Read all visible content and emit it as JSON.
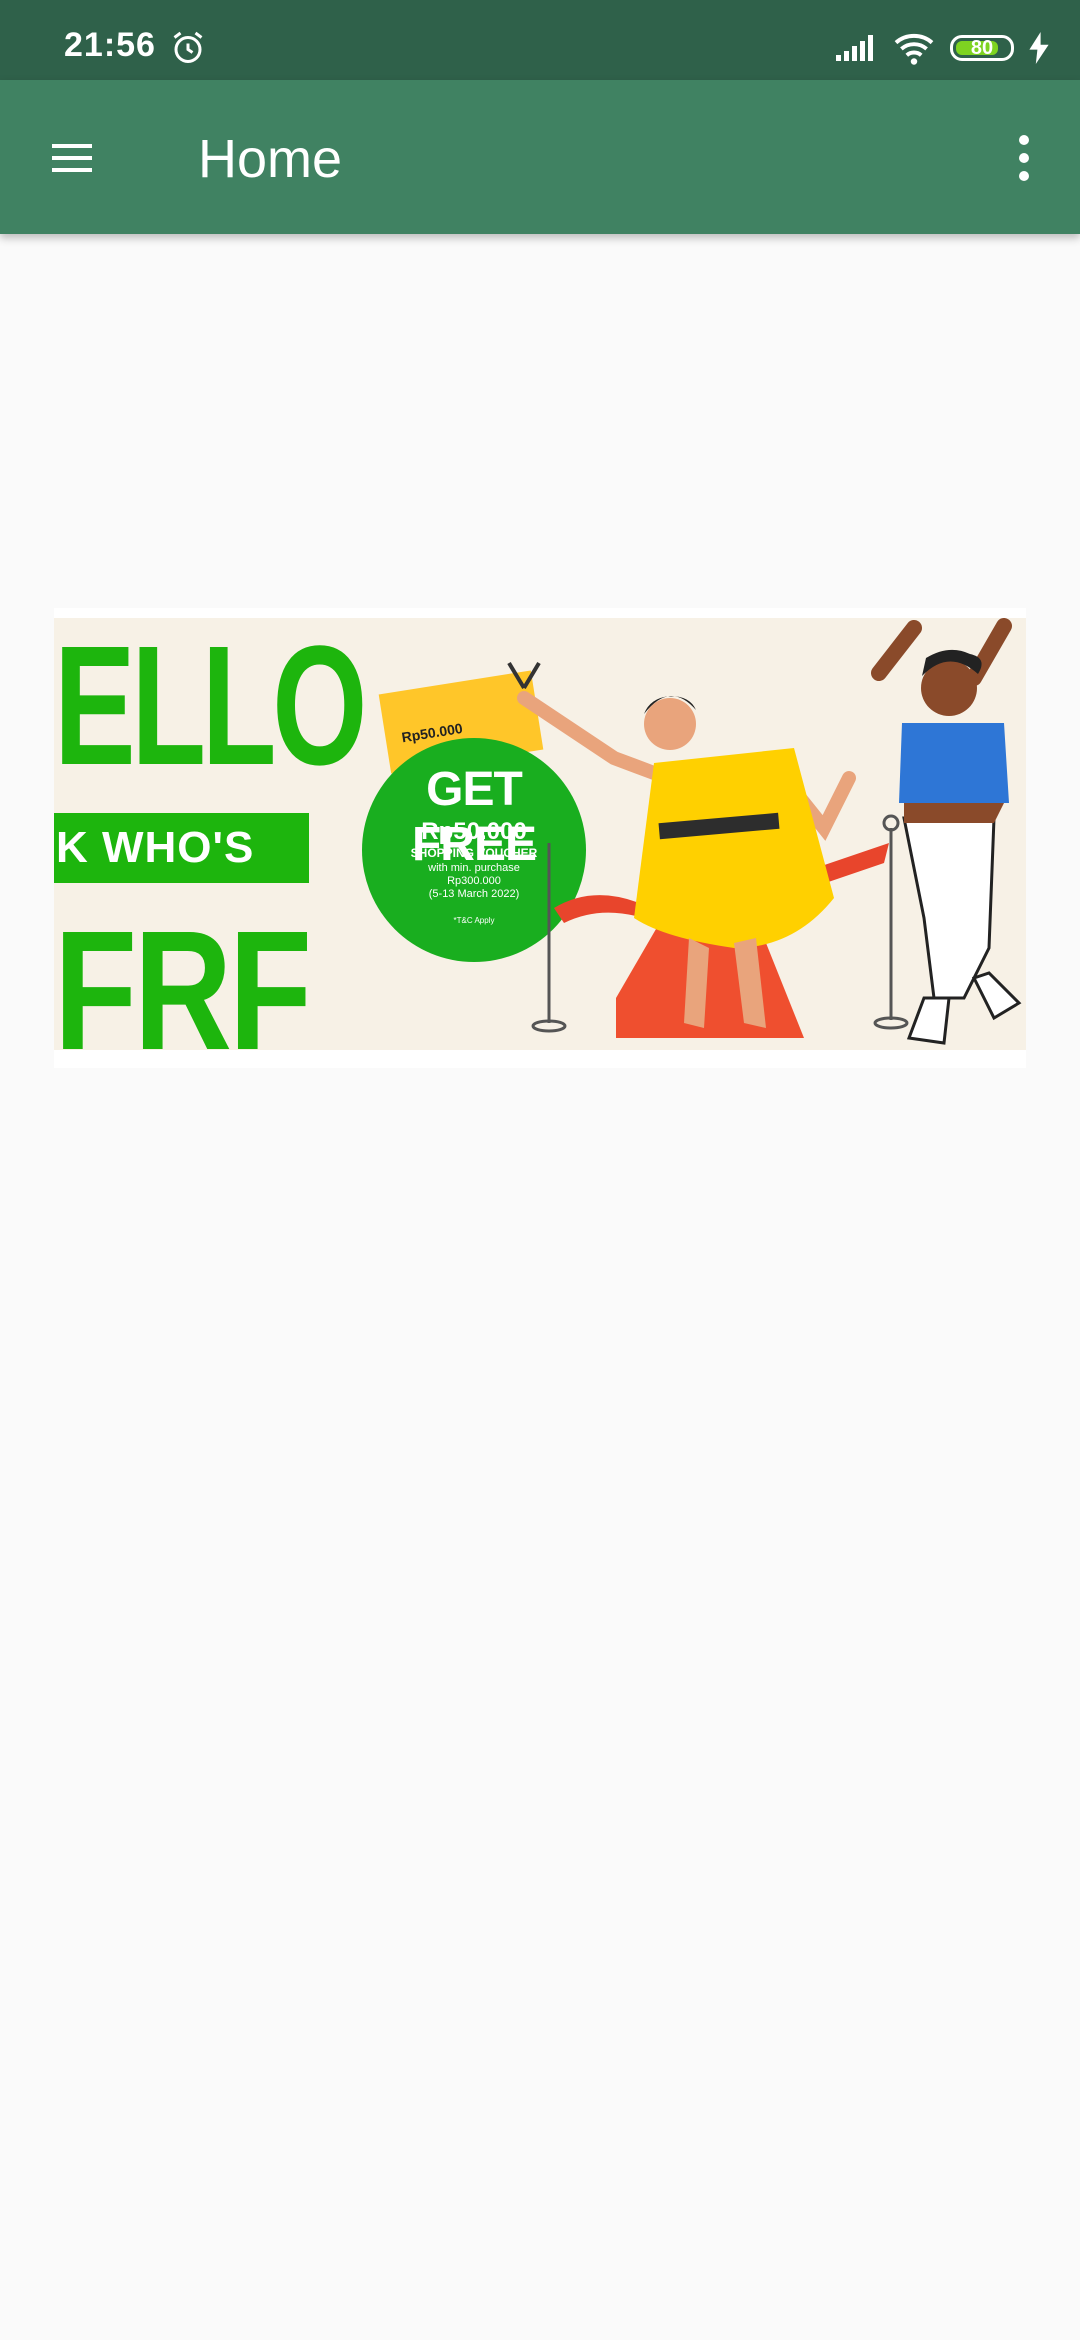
{
  "status_bar": {
    "time": "21:56",
    "battery_level": "80",
    "icons": [
      "alarm-icon",
      "signal-icon",
      "wifi-icon",
      "battery-icon",
      "charging-icon"
    ]
  },
  "app_bar": {
    "title": "Home",
    "menu_icon": "menu-icon",
    "more_icon": "more-vertical-icon"
  },
  "banner": {
    "headline_top": "ELLO",
    "headline_middle": "K WHO'S",
    "headline_bottom": "FRF",
    "voucher_amount": "Rp50.000",
    "offer_title": "GET FREE",
    "offer_amount": "Rp50.000",
    "offer_type": "SHOPPING VOUCHER",
    "offer_condition_1": "with min. purchase",
    "offer_condition_2": "Rp300.000",
    "offer_dates": "(5-13 March 2022)",
    "offer_terms": "*T&C Apply"
  },
  "colors": {
    "status_bar": "#2f614a",
    "app_bar": "#408262",
    "background": "#fafafa",
    "banner_green": "#1db50d"
  }
}
